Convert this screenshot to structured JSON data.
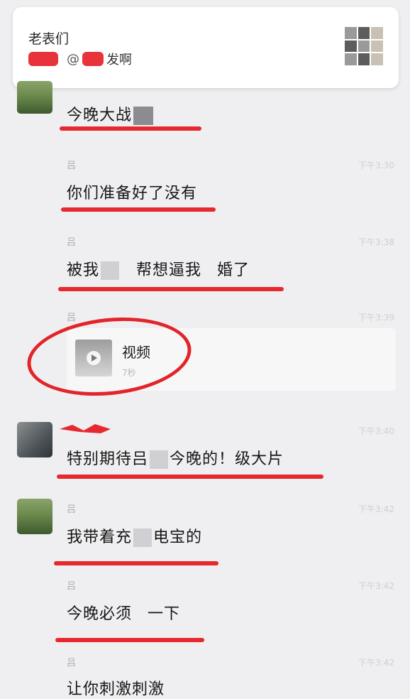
{
  "notification": {
    "group_name": "老表们",
    "mention": "@",
    "message_tail": "发啊"
  },
  "messages": [
    {
      "sender": "",
      "time": "",
      "text_parts": [
        "今晚大战",
        ""
      ]
    },
    {
      "sender": "吕",
      "time": "下午3:30",
      "text": "你们准备好了没有"
    },
    {
      "sender": "吕",
      "time": "下午3:38",
      "text_parts": [
        "被我",
        "帮想逼我",
        "婚了"
      ]
    },
    {
      "sender": "吕",
      "time": "下午3:39",
      "video": {
        "label": "视频",
        "duration": "7秒"
      }
    },
    {
      "sender": "",
      "time": "下午3:40",
      "text_parts": [
        "特别期待吕",
        "今晚的！",
        "级大片"
      ]
    },
    {
      "sender": "吕",
      "time": "下午3:42",
      "text_parts": [
        "我带着充",
        "电宝的"
      ]
    },
    {
      "sender": "吕",
      "time": "下午3:42",
      "text_parts": [
        "今晚必须",
        "一下"
      ]
    },
    {
      "sender": "吕",
      "time": "下午3:42",
      "text": "让你刺激刺激"
    }
  ],
  "colors": {
    "annotation_red": "#e7282e",
    "background": "#efeff1"
  }
}
